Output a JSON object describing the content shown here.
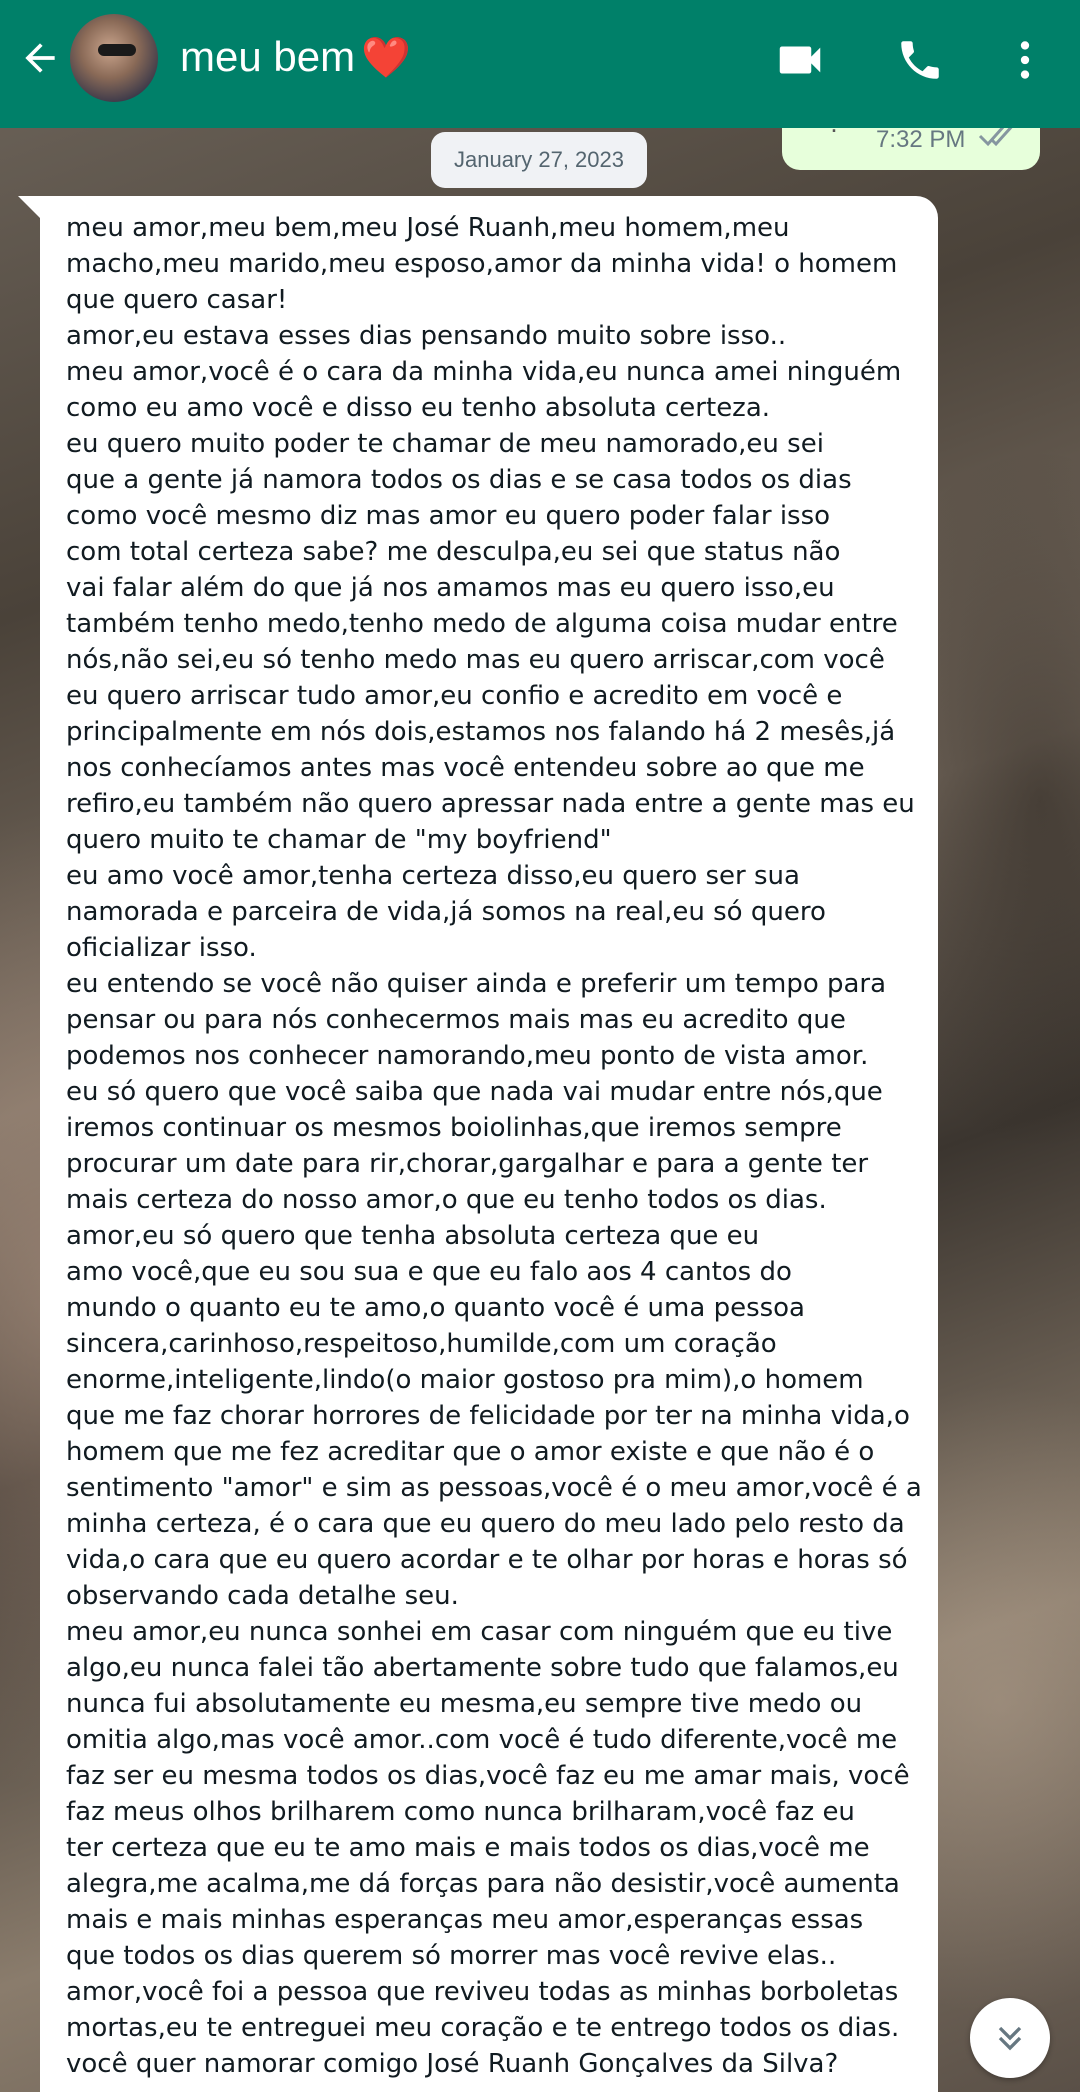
{
  "header": {
    "contact_name": "meu bem",
    "contact_emoji": "❤️",
    "back_icon": "arrow-left-icon",
    "video_icon": "video-camera-icon",
    "call_icon": "phone-icon",
    "menu_icon": "more-vert-icon",
    "background_color": "#008069"
  },
  "previous_message": {
    "fragment": "~ . ~",
    "time": "7:32 PM",
    "status_icon": "double-check-icon"
  },
  "date_chip": "January 27, 2023",
  "message": {
    "lines": [
      "meu amor,meu bem,meu José Ruanh,meu homem,meu",
      "macho,meu marido,meu esposo,amor da minha vida! o homem",
      "que quero casar!",
      "amor,eu estava esses dias pensando muito sobre isso..",
      "meu amor,você é o cara da minha vida,eu nunca amei ninguém",
      "como eu amo você e disso eu tenho absoluta certeza.",
      "eu quero muito poder te chamar de meu namorado,eu sei",
      "que a gente já namora todos os dias e se casa todos os dias",
      "como você mesmo diz mas amor eu quero poder falar isso",
      "com total certeza sabe? me desculpa,eu sei que status não",
      "vai falar além do que já nos amamos mas eu quero isso,eu",
      "também tenho medo,tenho medo de alguma coisa mudar entre",
      "nós,não sei,eu só tenho medo mas eu quero arriscar,com você",
      "eu quero arriscar tudo amor,eu confio e acredito em você e",
      "principalmente em nós dois,estamos nos falando há 2 mesês,já",
      "nos conhecíamos antes mas você entendeu sobre ao que me",
      "refiro,eu também não quero apressar nada entre a gente mas eu",
      "quero muito te chamar de \"my boyfriend\"",
      "eu amo você amor,tenha certeza disso,eu quero ser sua",
      "namorada e parceira de vida,já somos na real,eu só quero",
      "oficializar isso.",
      "eu entendo se você não quiser ainda e preferir um tempo para",
      "pensar ou para nós conhecermos mais mas eu acredito que",
      "podemos nos conhecer namorando,meu ponto de vista amor.",
      "eu só quero que você saiba que nada vai mudar entre nós,que",
      "iremos continuar os mesmos boiolinhas,que iremos sempre",
      "procurar um date para rir,chorar,gargalhar e para a gente ter",
      "mais certeza do nosso amor,o que eu tenho todos os dias.",
      "amor,eu só quero que tenha absoluta certeza que eu",
      "amo você,que eu sou sua e que eu falo aos 4 cantos do",
      "mundo o quanto eu te amo,o quanto você é uma pessoa",
      "sincera,carinhoso,respeitoso,humilde,com um coração",
      "enorme,inteligente,lindo(o maior gostoso pra mim),o homem",
      "que me faz chorar horrores de felicidade por ter na minha vida,o",
      "homem que me fez acreditar que o amor existe e que não é o",
      "sentimento \"amor\" e sim as pessoas,você é o meu amor,você é a",
      "minha certeza, é o cara que eu quero do meu lado pelo resto da",
      "vida,o cara que eu quero acordar e te olhar por horas e horas só",
      "observando cada detalhe seu.",
      "meu amor,eu nunca sonhei em casar com ninguém que eu tive",
      "algo,eu nunca falei tão abertamente sobre tudo que falamos,eu",
      "nunca fui absolutamente eu mesma,eu sempre tive medo ou",
      "omitia algo,mas você amor..com você é tudo diferente,você me",
      "faz ser eu mesma todos os dias,você faz eu me amar mais, você",
      "faz meus olhos brilharem como nunca brilharam,você faz eu",
      "ter certeza que eu te amo mais e mais todos os dias,você me",
      "alegra,me acalma,me dá forças para não desistir,você aumenta",
      "mais e mais minhas esperanças meu amor,esperanças essas",
      "que todos os dias querem só morrer mas você revive elas..",
      "amor,você foi a pessoa que reviveu todas as minhas borboletas",
      "mortas,eu te entreguei meu coração e te entrego todos os dias.",
      "você quer namorar comigo José Ruanh Gonçalves da Silva?"
    ]
  },
  "scroll_button_icon": "double-chevron-down-icon"
}
